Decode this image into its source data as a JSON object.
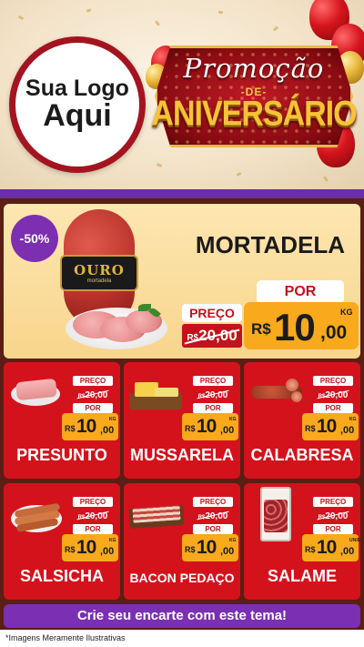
{
  "header": {
    "logo_line1": "Sua Logo",
    "logo_line2": "Aqui",
    "banner_promo": "Promoção",
    "banner_de": "-DE-",
    "banner_aniversario": "ANIVERSÁRIO"
  },
  "featured": {
    "discount": "-50%",
    "name": "MORTADELA",
    "brand_label": "OURO",
    "brand_sub": "mortadela",
    "preco_label": "PREÇO",
    "old_currency": "R$",
    "old_price": "20,00",
    "por_label": "POR",
    "currency": "R$",
    "price_int": "10",
    "price_dec": ",00",
    "unit": "KG"
  },
  "products": [
    {
      "name": "PRESUNTO",
      "preco_label": "PREÇO",
      "old_currency": "R$",
      "old_price": "20,00",
      "por_label": "POR",
      "currency": "R$",
      "price_int": "10",
      "price_dec": ",00",
      "unit": "KG"
    },
    {
      "name": "MUSSARELA",
      "preco_label": "PREÇO",
      "old_currency": "R$",
      "old_price": "20,00",
      "por_label": "POR",
      "currency": "R$",
      "price_int": "10",
      "price_dec": ",00",
      "unit": "KG"
    },
    {
      "name": "CALABRESA",
      "preco_label": "PREÇO",
      "old_currency": "R$",
      "old_price": "20,00",
      "por_label": "POR",
      "currency": "R$",
      "price_int": "10",
      "price_dec": ",00",
      "unit": "KG"
    },
    {
      "name": "SALSICHA",
      "preco_label": "PREÇO",
      "old_currency": "R$",
      "old_price": "20,00",
      "por_label": "POR",
      "currency": "R$",
      "price_int": "10",
      "price_dec": ",00",
      "unit": "KG"
    },
    {
      "name": "BACON PEDAÇO",
      "preco_label": "PREÇO",
      "old_currency": "R$",
      "old_price": "20,00",
      "por_label": "POR",
      "currency": "R$",
      "price_int": "10",
      "price_dec": ",00",
      "unit": "KG"
    },
    {
      "name": "SALAME",
      "preco_label": "PREÇO",
      "old_currency": "R$",
      "old_price": "20,00",
      "por_label": "POR",
      "currency": "R$",
      "price_int": "10",
      "price_dec": ",00",
      "unit": "UNID"
    }
  ],
  "cta": "Crie seu encarte com este tema!",
  "footer_note": "*Imagens Meramente Ilustrativas",
  "colors": {
    "red": "#d4121c",
    "orange": "#f8a91c",
    "purple": "#7b2fb3",
    "cream": "#fde6b1",
    "dark_brown": "#5a1e14"
  }
}
